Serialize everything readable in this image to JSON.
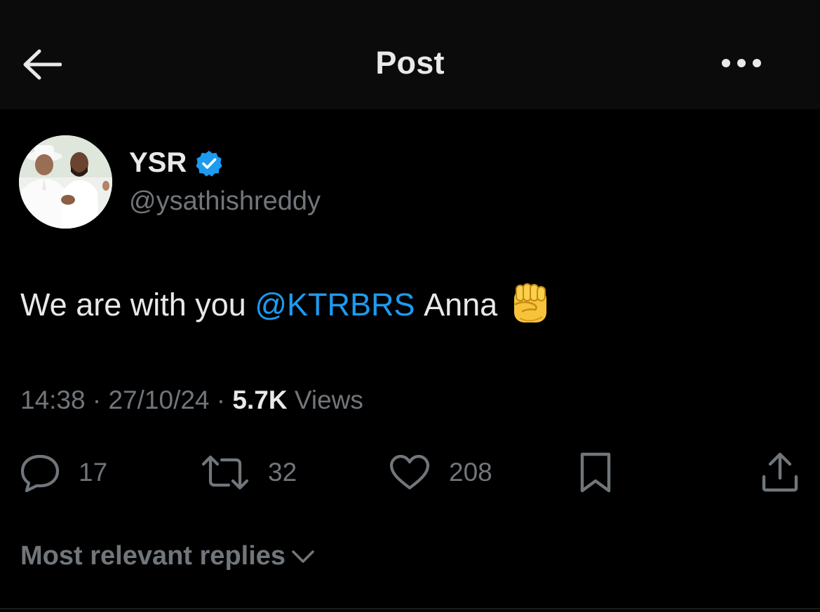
{
  "header": {
    "title": "Post",
    "back_icon": "arrow-left-icon",
    "more_icon": "more-horizontal-icon"
  },
  "author": {
    "name": "YSR",
    "handle": "@ysathishreddy",
    "verified": true,
    "verified_color": "#1d9bf0"
  },
  "post": {
    "text_before": "We are with you",
    "mention": "@KTRBRS",
    "text_after": "Anna",
    "emoji": "raised-fist"
  },
  "meta": {
    "time": "14:38",
    "sep1": "·",
    "date": "27/10/24",
    "sep2": "·",
    "views_count": "5.7K",
    "views_label": "Views"
  },
  "actions": {
    "replies": "17",
    "reposts": "32",
    "likes": "208"
  },
  "replies_sort": {
    "label": "Most relevant replies"
  },
  "colors": {
    "background": "#000000",
    "header_bg": "#0b0b0b",
    "primary_text": "#e7e9ea",
    "secondary_text": "#71767b",
    "accent": "#1d9bf0"
  }
}
